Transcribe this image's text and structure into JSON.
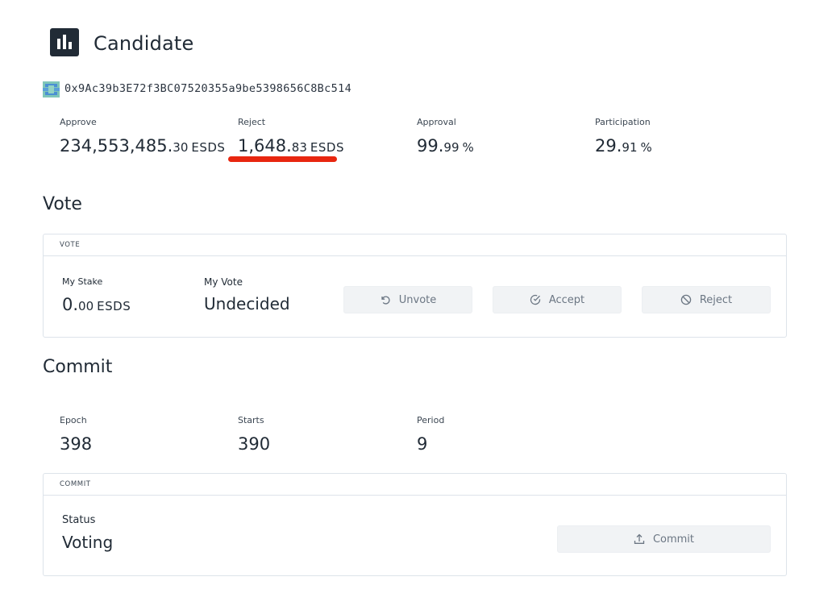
{
  "header": {
    "title": "Candidate"
  },
  "address": {
    "text": "0x9Ac39b3E72f3BC07520355a9be5398656C8Bc514"
  },
  "stats": {
    "approve": {
      "label": "Approve",
      "int": "234,553,485.",
      "dec": "30",
      "unit": "ESDS"
    },
    "reject": {
      "label": "Reject",
      "int": "1,648.",
      "dec": "83",
      "unit": "ESDS"
    },
    "approval": {
      "label": "Approval",
      "int": "99.",
      "dec": "99",
      "unit": "%"
    },
    "participation": {
      "label": "Participation",
      "int": "29.",
      "dec": "91",
      "unit": "%"
    }
  },
  "vote": {
    "section_title": "Vote",
    "box_header": "VOTE",
    "my_stake": {
      "label": "My Stake",
      "int": "0.",
      "dec": "00",
      "unit": "ESDS"
    },
    "my_vote": {
      "label": "My Vote",
      "value": "Undecided"
    },
    "buttons": {
      "unvote": "Unvote",
      "accept": "Accept",
      "reject": "Reject"
    }
  },
  "commit": {
    "section_title": "Commit",
    "epoch": {
      "label": "Epoch",
      "value": "398"
    },
    "starts": {
      "label": "Starts",
      "value": "390"
    },
    "period": {
      "label": "Period",
      "value": "9"
    },
    "box_header": "COMMIT",
    "status": {
      "label": "Status",
      "value": "Voting"
    },
    "button": "Commit"
  },
  "colors": {
    "text": "#212b36",
    "border": "#dde3ea",
    "button_bg": "#f1f3f5",
    "button_text": "#6b7683",
    "annotation_red": "#e8260f"
  },
  "icons": {
    "logo": "bar-chart-icon",
    "address": "identicon-icon",
    "unvote": "undo-icon",
    "accept": "check-circle-icon",
    "reject": "block-icon",
    "commit": "upload-icon"
  }
}
